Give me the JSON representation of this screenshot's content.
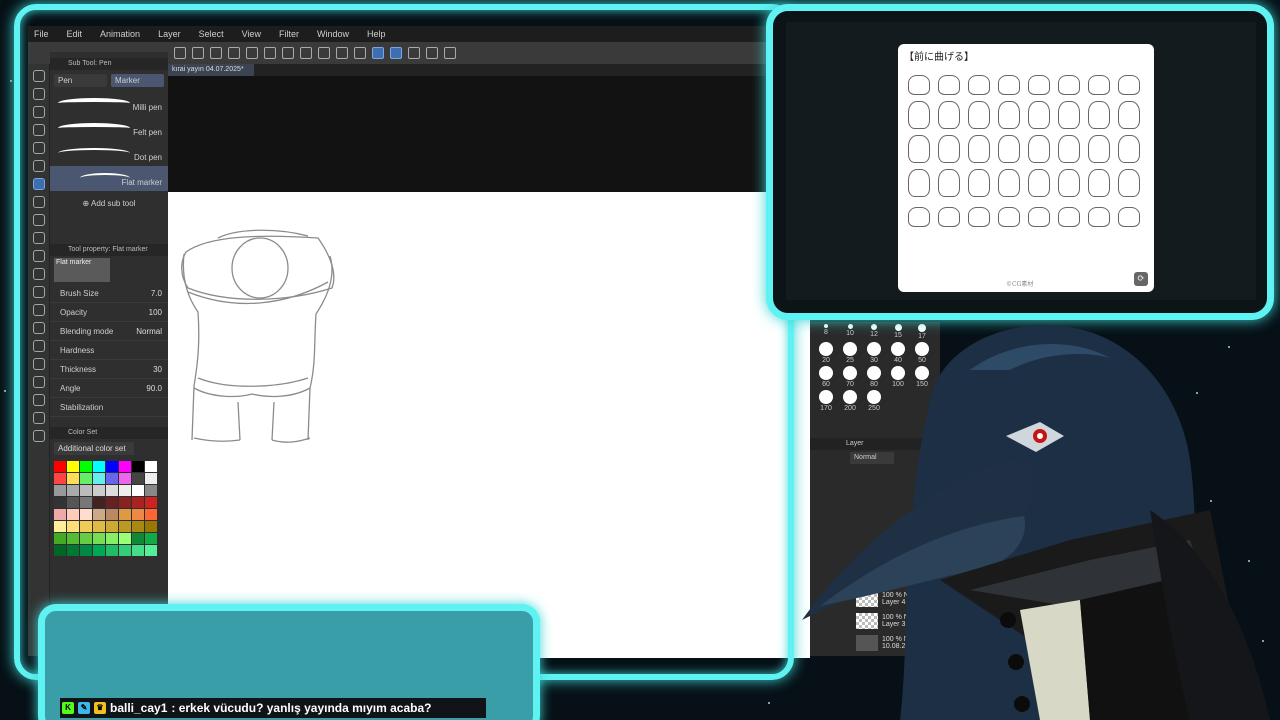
{
  "menubar": {
    "items": [
      "File",
      "Edit",
      "Animation",
      "Layer",
      "Select",
      "View",
      "Filter",
      "Window",
      "Help"
    ]
  },
  "document_tab": {
    "label": "kırai yayın 04.07.2025*"
  },
  "subtool": {
    "header": "Sub Tool: Pen",
    "tabs": [
      "Pen",
      "Marker"
    ],
    "brushes": [
      "Milli pen",
      "Felt pen",
      "Dot pen",
      "Flat marker"
    ],
    "add_label": "Add sub tool"
  },
  "tool_property": {
    "header": "Tool property: Flat marker",
    "preview_label": "Flat marker",
    "rows": [
      {
        "label": "Brush Size",
        "value": "7.0"
      },
      {
        "label": "Opacity",
        "value": "100"
      },
      {
        "label": "Blending mode",
        "value": "Normal"
      },
      {
        "label": "Hardness",
        "value": ""
      },
      {
        "label": "Thickness",
        "value": "30"
      },
      {
        "label": "Angle",
        "value": "90.0"
      },
      {
        "label": "Stabilization",
        "value": ""
      }
    ]
  },
  "color_set": {
    "header": "Color Set",
    "selected": "Additional color set"
  },
  "brush_sizes": [
    "8",
    "10",
    "12",
    "15",
    "17",
    "20",
    "25",
    "30",
    "40",
    "50",
    "60",
    "70",
    "80",
    "100",
    "150",
    "170",
    "200",
    "250"
  ],
  "layers": {
    "header": "Layer",
    "blend_mode": "Normal",
    "items": [
      {
        "opacity": "100 % Nor",
        "name": "Layer 4"
      },
      {
        "opacity": "100 % Nor",
        "name": "Layer 3"
      },
      {
        "opacity": "100 % Nor",
        "name": "10.08.202"
      }
    ]
  },
  "reference": {
    "title": "【前に曲げる】",
    "credit": "©CG素材"
  },
  "chat": {
    "username": "balli_cay1",
    "message": " : erkek vücudu? yanlış yayında mıyım acaba?"
  },
  "colors": {
    "frame_cyan": "#5ff2f2",
    "chat_bg": "#3a9ea8",
    "accent_blue": "#3d6fb0"
  }
}
